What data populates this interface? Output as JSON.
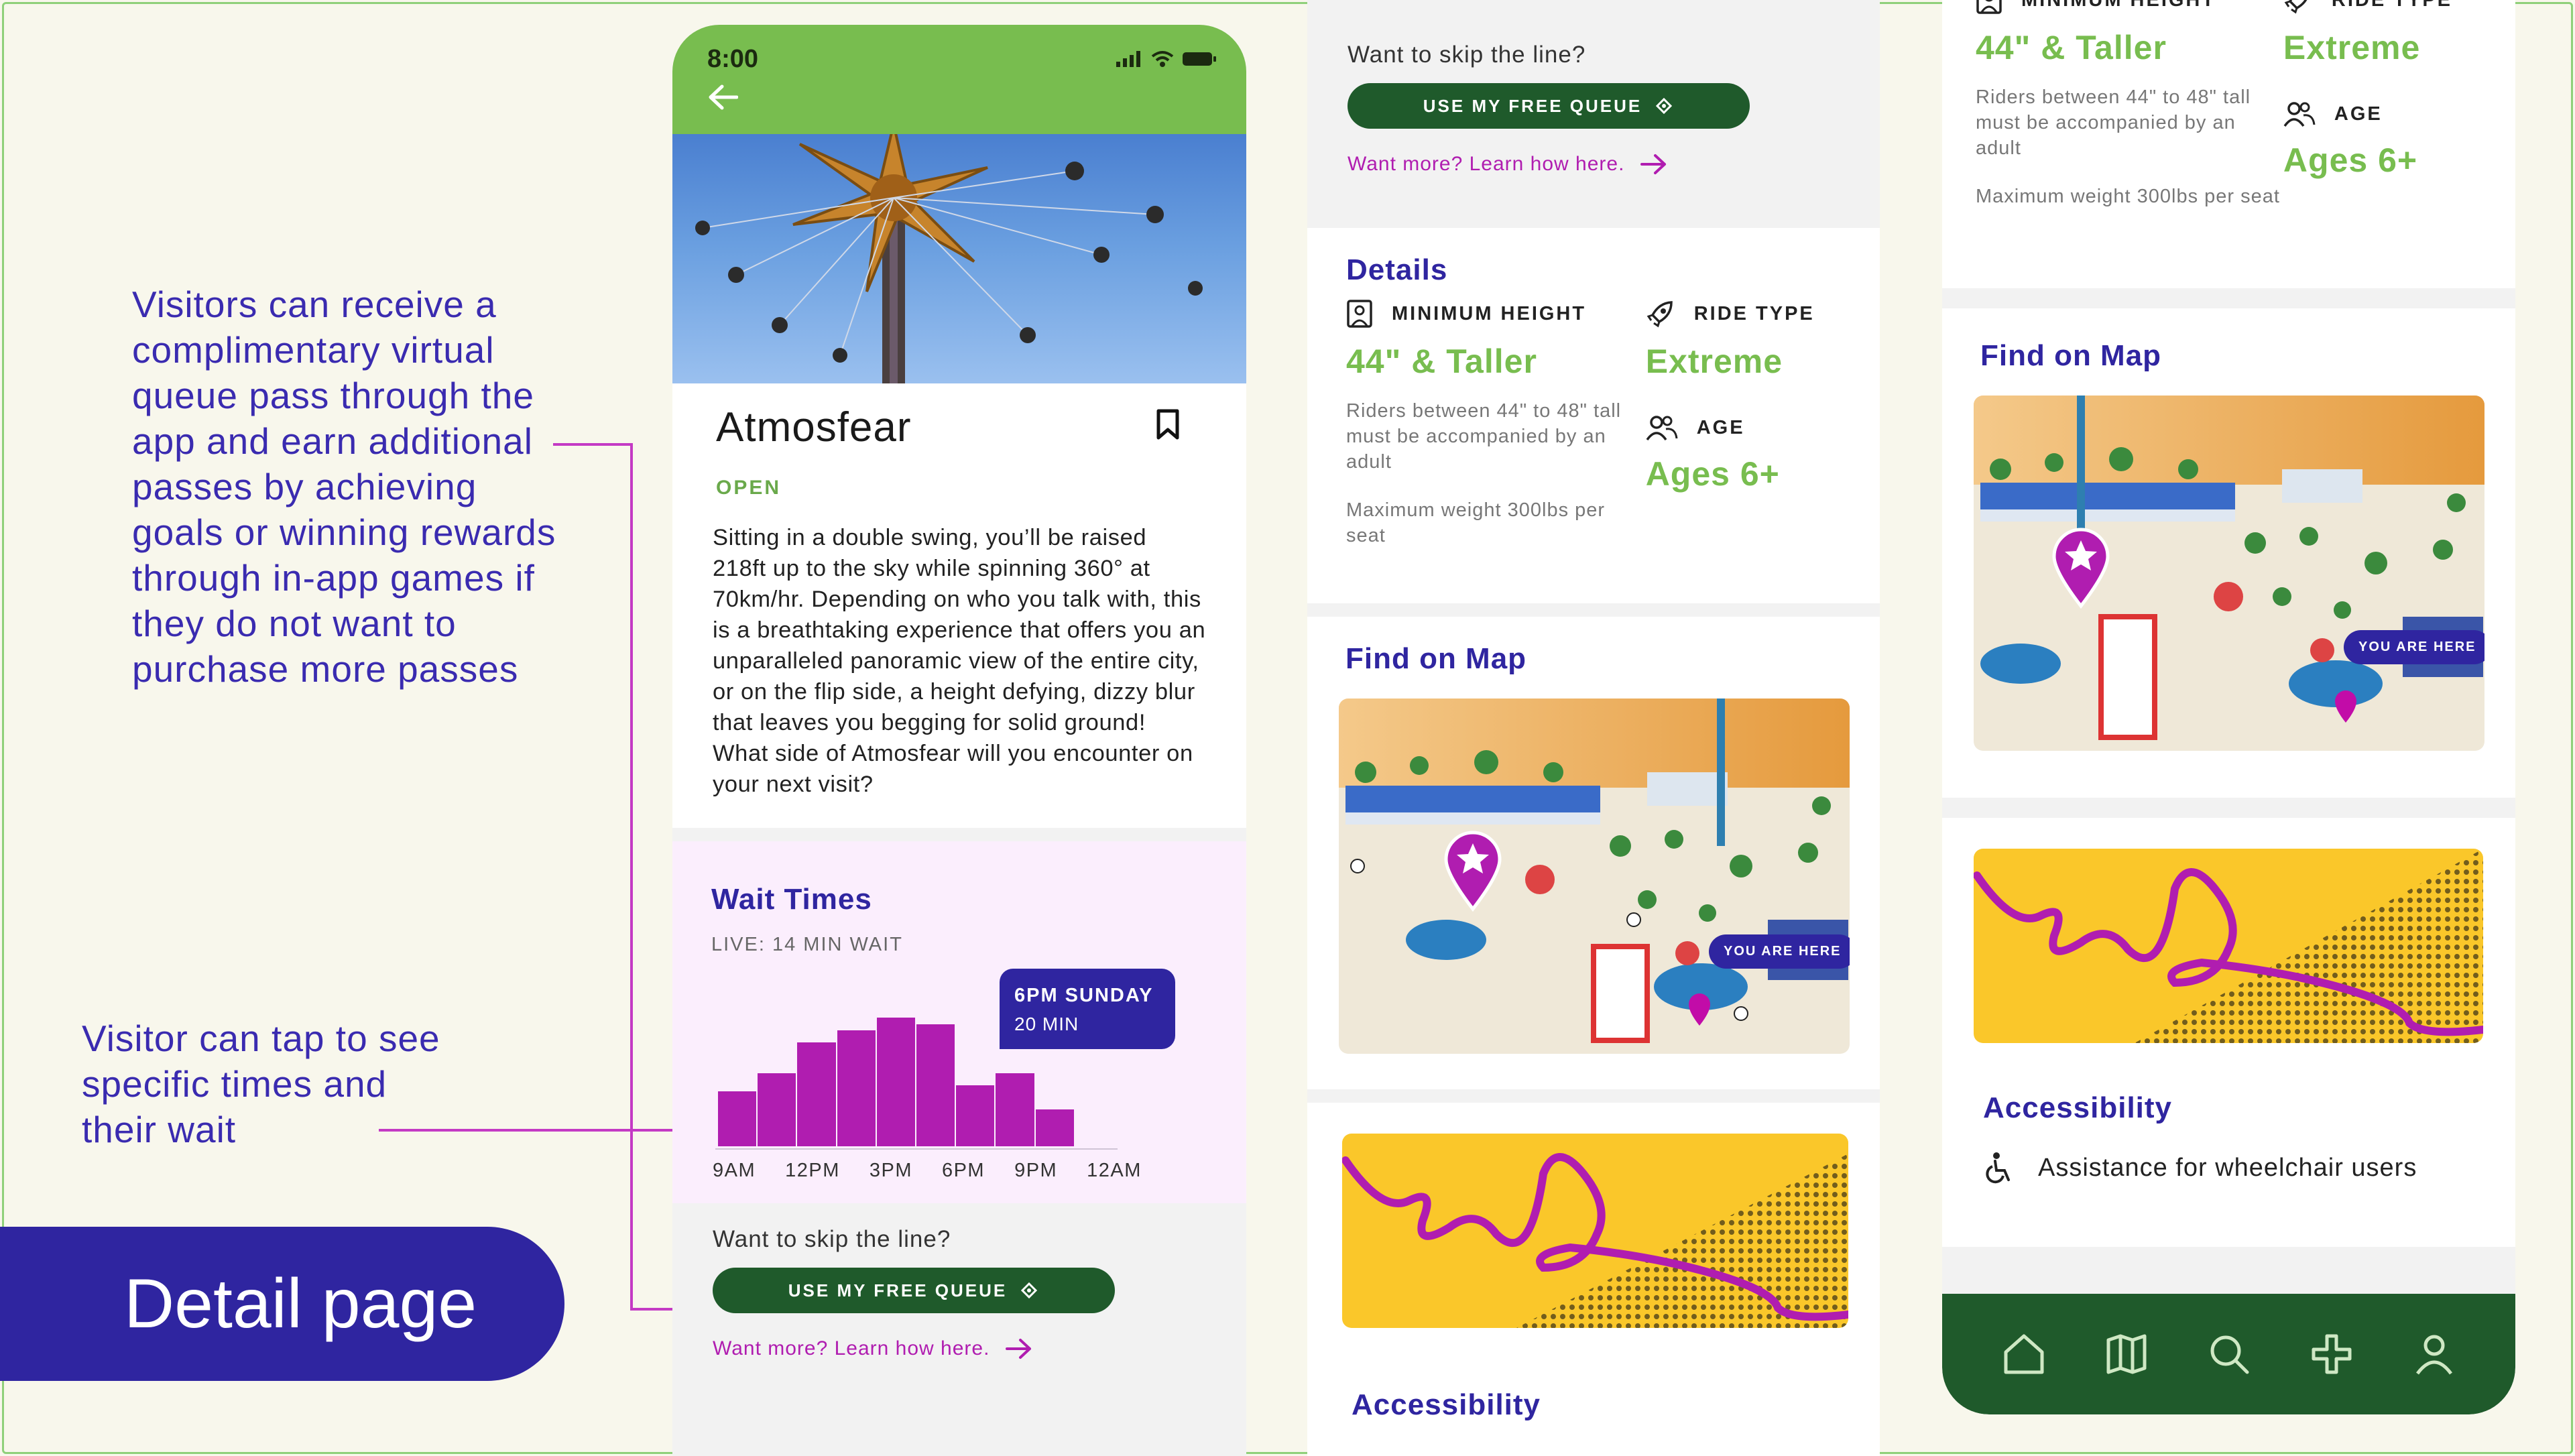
{
  "annotations": {
    "note1": "Visitors can receive a complimentary virtual queue pass through the app and earn additional passes by achieving goals or winning rewards through in-app games if they do not want to purchase more passes",
    "note2": "Visitor can tap to see specific times and their wait",
    "page_label": "Detail page"
  },
  "status": {
    "time": "8:00"
  },
  "ride": {
    "name": "Atmosfear",
    "status": "OPEN",
    "description": "Sitting in a double swing, you’ll be raised 218ft up to the sky while spinning 360° at 70km/hr. Depending on who you talk with, this is a breathtaking experience that offers you an unparalleled panoramic view of the entire city, or on the flip side, a height defying, dizzy blur that leaves you begging for solid ground! What side of Atmosfear will you encounter on your next visit?"
  },
  "wait_times": {
    "title": "Wait Times",
    "live": "LIVE: 14 MIN WAIT",
    "tooltip_day": "6PM SUNDAY",
    "tooltip_wait": "20 MIN",
    "x_labels": [
      "9AM",
      "12PM",
      "3PM",
      "6PM",
      "9PM",
      "12AM"
    ]
  },
  "chart_data": {
    "type": "bar",
    "title": "Wait Times",
    "xlabel": "",
    "ylabel": "",
    "categories": [
      "9AM",
      "",
      "12PM",
      "",
      "3PM",
      "",
      "6PM",
      "",
      "9PM",
      ""
    ],
    "values": [
      9,
      12,
      17,
      19,
      21,
      20,
      10,
      12,
      6,
      0
    ],
    "highlight": {
      "label": "6PM SUNDAY",
      "value": "20 MIN"
    },
    "bar_color": "#b01db0",
    "ylim": [
      0,
      25
    ],
    "grid": false
  },
  "skip": {
    "question": "Want to skip the line?",
    "button": "USE MY FREE QUEUE",
    "learn_more": "Want more? Learn how here."
  },
  "details": {
    "title": "Details",
    "min_height_label": "MINIMUM HEIGHT",
    "min_height_value": "44\" & Taller",
    "min_height_note": "Riders between 44\" to 48\" tall must be accompanied by an adult",
    "weight_note": "Maximum weight 300lbs per seat",
    "ride_type_label": "RIDE TYPE",
    "ride_type_value": "Extreme",
    "age_label": "AGE",
    "age_value": "Ages 6+"
  },
  "map": {
    "title": "Find on Map",
    "you_are_here": "YOU ARE HERE"
  },
  "accessibility": {
    "title": "Accessibility",
    "item": "Assistance for wheelchair users"
  },
  "colors": {
    "brand_green": "#78bd4f",
    "dark_green": "#1f5a2b",
    "accent_purple": "#2f25a0",
    "accent_magenta": "#b01db0"
  },
  "nav": [
    "home-icon",
    "map-icon",
    "search-icon",
    "games-icon",
    "profile-icon"
  ]
}
